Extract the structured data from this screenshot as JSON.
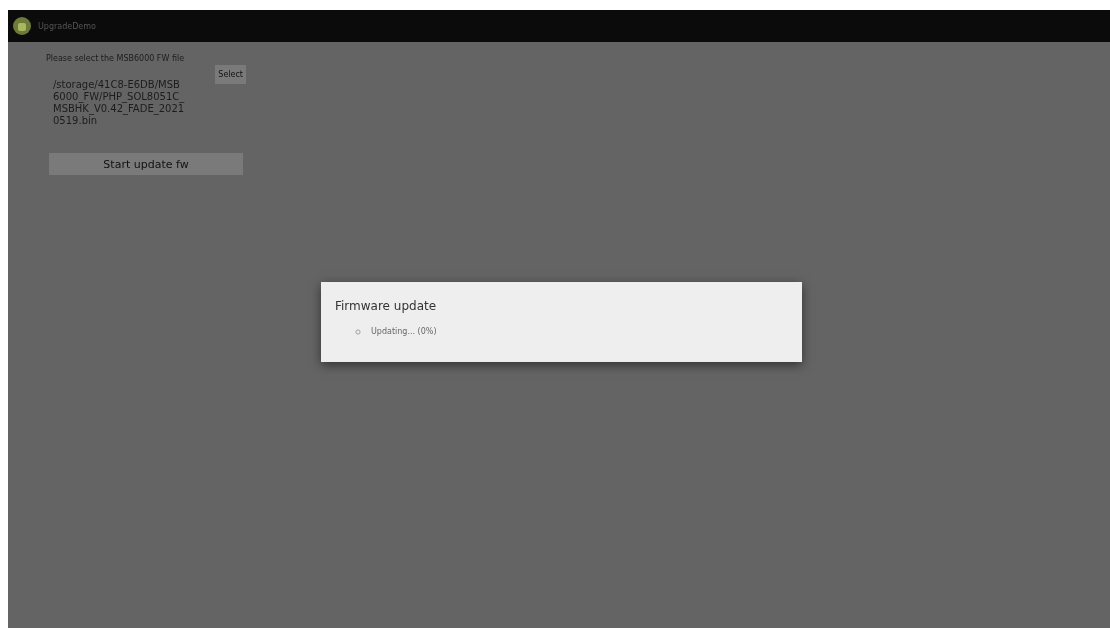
{
  "app_bar": {
    "title": "UpgradeDemo"
  },
  "content": {
    "prompt": "Please select the MSB6000 FW file",
    "select_button": "Select",
    "file_path": "/storage/41C8-E6DB/MSB6000_FW/PHP_SOL8051C_MSBHK_V0.42_FADE_20210519.bin",
    "start_button": "Start update fw"
  },
  "dialog": {
    "title": "Firmware update",
    "message": "Updating... (0%)"
  }
}
